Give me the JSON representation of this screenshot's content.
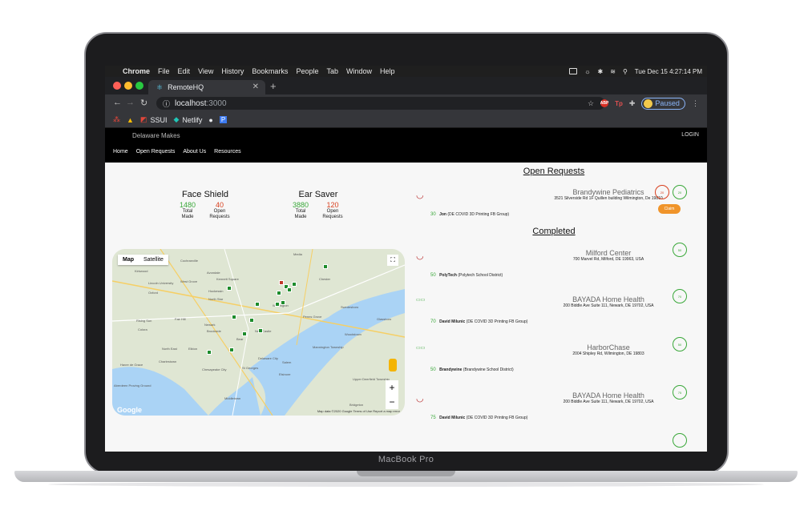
{
  "device": {
    "label": "MacBook Pro"
  },
  "menubar": {
    "items": [
      "Chrome",
      "File",
      "Edit",
      "View",
      "History",
      "Bookmarks",
      "People",
      "Tab",
      "Window",
      "Help"
    ],
    "clock": "Tue Dec 15  4:27:14 PM"
  },
  "browser": {
    "tab_title": "RemoteHQ",
    "url_host": "localhost",
    "url_port": ":3000",
    "profile_status": "Paused",
    "extensions": {
      "abp": "ABP",
      "tp": "Tp"
    },
    "bookmarks": [
      "SSUI",
      "Netlify"
    ]
  },
  "site": {
    "brand": "Delaware Makes",
    "login": "LOGIN",
    "nav": [
      "Home",
      "Open Requests",
      "About Us",
      "Resources"
    ]
  },
  "stats": [
    {
      "title": "Face Shield",
      "made": "1480",
      "open": "40",
      "made_label": "Total Made",
      "open_label": "Open Requests"
    },
    {
      "title": "Ear Saver",
      "made": "3880",
      "open": "120",
      "made_label": "Total Made",
      "open_label": "Open Requests"
    }
  ],
  "map": {
    "tab_map": "Map",
    "tab_satellite": "Satellite",
    "zoom_in": "+",
    "zoom_out": "−",
    "logo": "Google",
    "attribution": "Map data ©2020 Google   Terms of Use   Report a map error",
    "places": [
      "Cochranville",
      "Kirkwood",
      "Lincoln University",
      "Oxford",
      "West Grove",
      "Avondale",
      "Kennett Square",
      "Hockessin",
      "North Star",
      "Newark",
      "Elkton",
      "North East",
      "Brookside",
      "Bear",
      "New Castle",
      "Wilmington",
      "Media",
      "Chester",
      "Swedesboro",
      "Penns Grove",
      "Woodstown",
      "Glassboro",
      "Rising Sun",
      "Colora",
      "Fair Hill",
      "Charlestown",
      "Havre de Grace",
      "Chesapeake City",
      "St Georges",
      "Delaware City",
      "Middletown",
      "Salem",
      "Elsinore",
      "Mannington Township",
      "Upper Deerfield Township",
      "Bridgeton",
      "Aberdeen Proving Ground"
    ]
  },
  "open_requests": {
    "title": "Open Requests",
    "items": [
      {
        "name": "Brandywine Pediatrics",
        "address": "3521 Silverside Rd 1F Quillen building Wilmington, De 19810",
        "count": "30",
        "maker": "Jon",
        "group": "(DE COVID 3D Printing FB Group)",
        "claim": "Claim",
        "circle_red": "20",
        "circle_green": "20"
      }
    ]
  },
  "completed": {
    "title": "Completed",
    "items": [
      {
        "name": "Milford Center",
        "address": "700 Marvel Rd, Milford, DE 19963, USA",
        "count": "50",
        "maker": "PolyTech",
        "group": "(Polytech School District)",
        "circle": "50"
      },
      {
        "name": "BAYADA Home Health",
        "address": "200 Biddle Ave Suite 111, Newark, DE 19702, USA",
        "count": "70",
        "maker": "David Milunic",
        "group": "(DE COVID 3D Printing FB Group)",
        "circle": "70"
      },
      {
        "name": "HarborChase",
        "address": "2004 Shipley Rd, Wilmington, DE 19803",
        "count": "50",
        "maker": "Brandywine",
        "group": "(Brandywine School District)",
        "circle": "50"
      },
      {
        "name": "BAYADA Home Health",
        "address": "200 Biddle Ave Suite 111, Newark, DE 19702, USA",
        "count": "75",
        "maker": "David Milunic",
        "group": "(DE COVID 3D Printing FB Group)",
        "circle": "75"
      }
    ]
  }
}
